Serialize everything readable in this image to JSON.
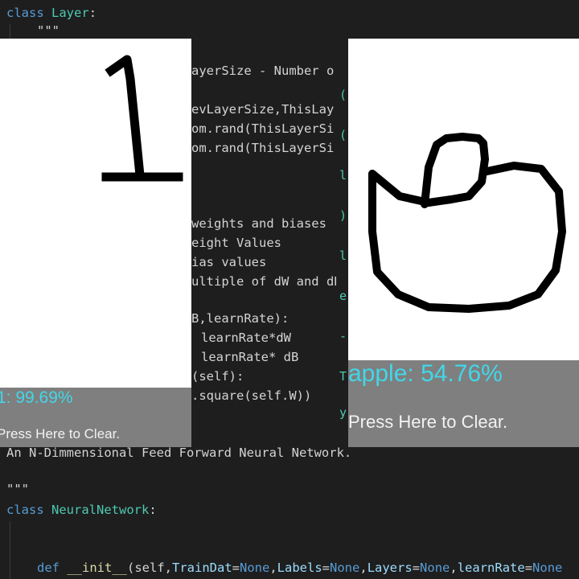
{
  "editor": {
    "class_layer_kw": "class",
    "class_layer_name": "Layer",
    "class_layer_colon": ":",
    "docstring_open": "\"\"\"",
    "frag_layer_size": "ayerSize - Number o",
    "frag_prev_layer": "evLayerSize,ThisLay",
    "frag_rand1": "om.rand(ThisLayerSi",
    "frag_rand2": "om.rand(ThisLayerSi",
    "frag_weights_biases": "weights and biases",
    "frag_weight_values": "eight Values",
    "frag_bias_values": "ias values",
    "frag_multiple": "ultiple of dW and dB",
    "frag_learnrate_sig": "B,learnRate):",
    "frag_learnrate_dw": "learnRate*dW",
    "frag_learnrate_db": "learnRate* dB",
    "frag_self": "(self):",
    "frag_square": ".square(self.W))",
    "docstring_nn": "An N-Dimmensional Feed Forward Neural Network.",
    "docstring_close": "\"\"\"",
    "class_nn_kw": "class",
    "class_nn_name": "NeuralNetwork",
    "class_nn_colon": ":",
    "init_line": {
      "def": "def",
      "name": "__init__",
      "params": "(self,",
      "p1": "TrainDat",
      "none1": "None",
      "p2": "Labels",
      "none2": "None",
      "p3": "Layers",
      "none3": "None",
      "p4": "learnRate",
      "none4": "None"
    }
  },
  "windows": [
    {
      "drawing": "digit-one",
      "prediction": "1: 99.69%",
      "clear_label": "Press Here to Clear."
    },
    {
      "drawing": "apple",
      "prediction": "apple: 54.76%",
      "clear_label": "Press Here to Clear."
    }
  ],
  "colors": {
    "editor_bg": "#1e1e1e",
    "prediction_text": "#41d7e8",
    "footer_bg": "#7f7f7f",
    "canvas_bg": "#ffffff",
    "stroke": "#000000"
  }
}
